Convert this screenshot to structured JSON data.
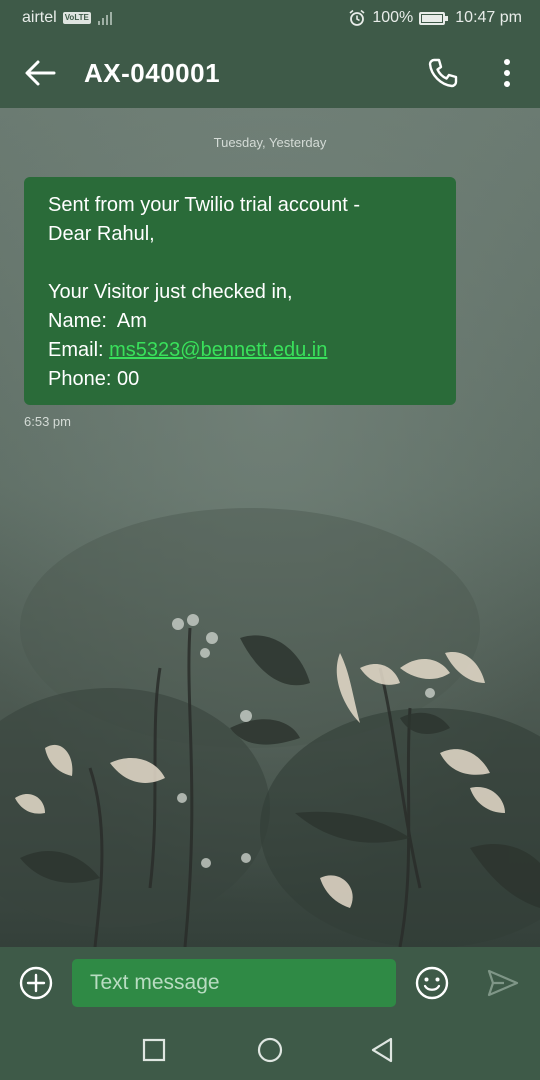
{
  "status_bar": {
    "carrier": "airtel",
    "volte_badge": "VoLTE",
    "battery": "100%",
    "time": "10:47 pm",
    "icons": [
      "signal-icon",
      "alarm-icon",
      "battery-icon"
    ]
  },
  "header": {
    "title": "AX-040001",
    "icons": [
      "back-arrow-icon",
      "phone-icon",
      "more-vert-icon"
    ]
  },
  "conversation": {
    "date_label": "Tuesday, Yesterday",
    "message": {
      "lines": [
        "Sent from your Twilio trial account -",
        "Dear Rahul,",
        "",
        "Your Visitor just checked in,",
        "Name:  Am"
      ],
      "email_prefix": "Email: ",
      "email": "ms5323@bennett.edu.in",
      "phone_line": "Phone: 00"
    },
    "time_label": "6:53 pm"
  },
  "composer": {
    "placeholder": "Text message",
    "value": "",
    "icons": [
      "add-circle-icon",
      "emoji-icon",
      "send-icon"
    ]
  },
  "nav_bar": {
    "icons": [
      "recent-apps-icon",
      "home-icon",
      "back-triangle-icon"
    ]
  },
  "colors": {
    "chrome": "#3e5a48",
    "bubble": "#2a6b39",
    "input": "#2f8a45",
    "link": "#39e05b"
  }
}
